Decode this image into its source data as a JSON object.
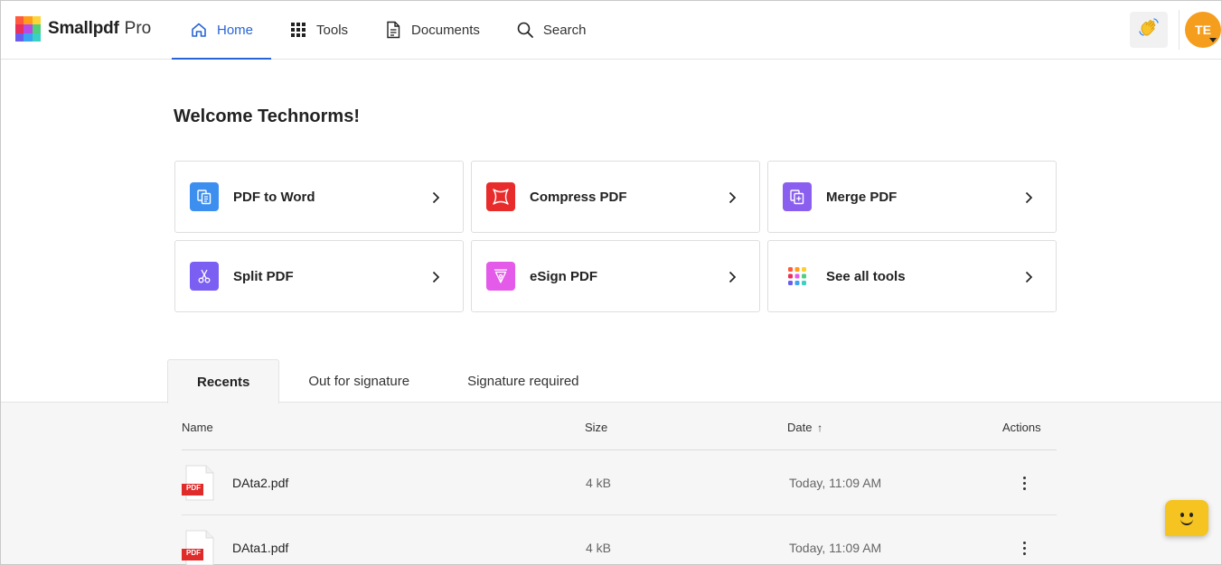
{
  "brand": {
    "name": "Smallpdf",
    "suffix": "Pro"
  },
  "nav": [
    {
      "label": "Home",
      "icon": "home-icon",
      "active": true
    },
    {
      "label": "Tools",
      "icon": "grid-icon",
      "active": false
    },
    {
      "label": "Documents",
      "icon": "document-icon",
      "active": false
    },
    {
      "label": "Search",
      "icon": "search-icon",
      "active": false
    }
  ],
  "header": {
    "wave_icon": "waving-hand-icon",
    "avatar_initials": "TE"
  },
  "welcome": "Welcome Technorms!",
  "tools": [
    {
      "label": "PDF to Word",
      "icon": "pdf-to-word-icon",
      "color": "#3d8fef"
    },
    {
      "label": "Compress PDF",
      "icon": "compress-icon",
      "color": "#e82c2c"
    },
    {
      "label": "Merge PDF",
      "icon": "merge-icon",
      "color": "#8a5ff0"
    },
    {
      "label": "Split PDF",
      "icon": "scissors-icon",
      "color": "#7b5ff2"
    },
    {
      "label": "eSign PDF",
      "icon": "pen-nib-icon",
      "color": "#e45bea"
    },
    {
      "label": "See all tools",
      "icon": "dots-grid-icon",
      "color": "#ffffff"
    }
  ],
  "tabs": [
    {
      "label": "Recents",
      "active": true
    },
    {
      "label": "Out for signature",
      "active": false
    },
    {
      "label": "Signature required",
      "active": false
    }
  ],
  "table": {
    "columns": {
      "name": "Name",
      "size": "Size",
      "date": "Date",
      "date_sort": "↑",
      "actions": "Actions"
    },
    "rows": [
      {
        "name": "DAta2.pdf",
        "size": "4 kB",
        "date": "Today, 11:09 AM",
        "badge": "PDF"
      },
      {
        "name": "DAta1.pdf",
        "size": "4 kB",
        "date": "Today, 11:09 AM",
        "badge": "PDF"
      }
    ]
  },
  "colors": {
    "accent": "#2764d6",
    "avatar": "#f59e1e",
    "pdf_badge": "#e02b2b",
    "chat": "#f5c421"
  }
}
